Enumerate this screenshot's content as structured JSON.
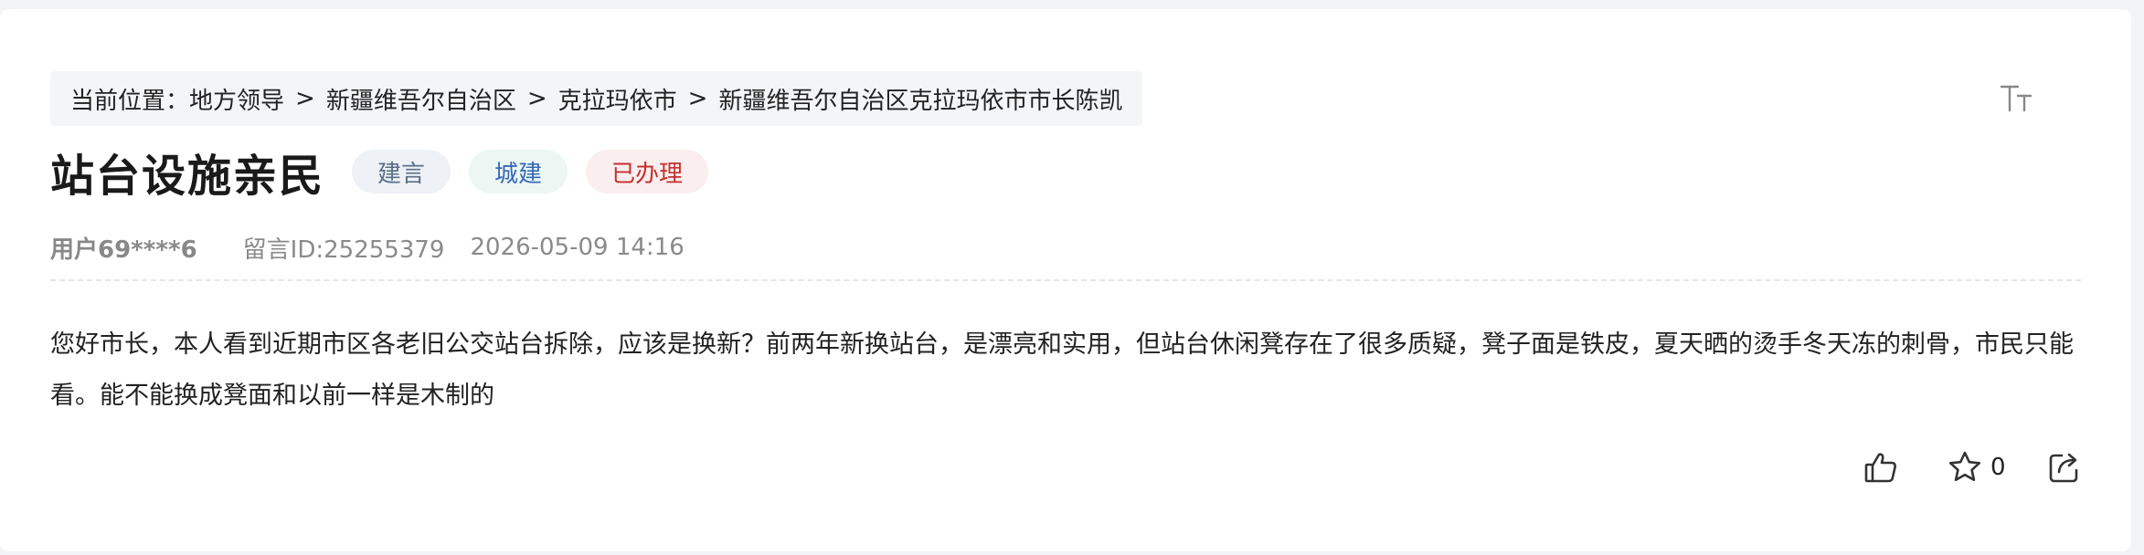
{
  "breadcrumb": {
    "prefix": "当前位置：",
    "items": [
      "地方领导",
      "新疆维吾尔自治区",
      "克拉玛依市",
      "新疆维吾尔自治区克拉玛依市市长陈凯"
    ],
    "separator": ">"
  },
  "toolbar": {
    "font_size_icon": "text-size-icon"
  },
  "post": {
    "title": "站台设施亲民",
    "tags": {
      "type": "建言",
      "domain": "城建",
      "status": "已办理"
    },
    "user": "用户69****6",
    "message_id": "留言ID:25255379",
    "datetime": "2026-05-09 14:16",
    "content": "您好市长，本人看到近期市区各老旧公交站台拆除，应该是换新？前两年新换站台，是漂亮和实用，但站台休闲凳存在了很多质疑，凳子面是铁皮，夏天晒的烫手冬天冻的刺骨，市民只能看。能不能换成凳面和以前一样是木制的"
  },
  "actions": {
    "like_icon": "thumbs-up-icon",
    "favorite_icon": "star-icon",
    "favorite_count": "0",
    "share_icon": "share-icon"
  },
  "colors": {
    "tag_type_bg": "#eef2f7",
    "tag_type_text": "#5a6f86",
    "tag_domain_bg": "#ecf7f4",
    "tag_domain_text": "#3869b8",
    "tag_status_bg": "#fbeeee",
    "tag_status_text": "#c53030"
  }
}
